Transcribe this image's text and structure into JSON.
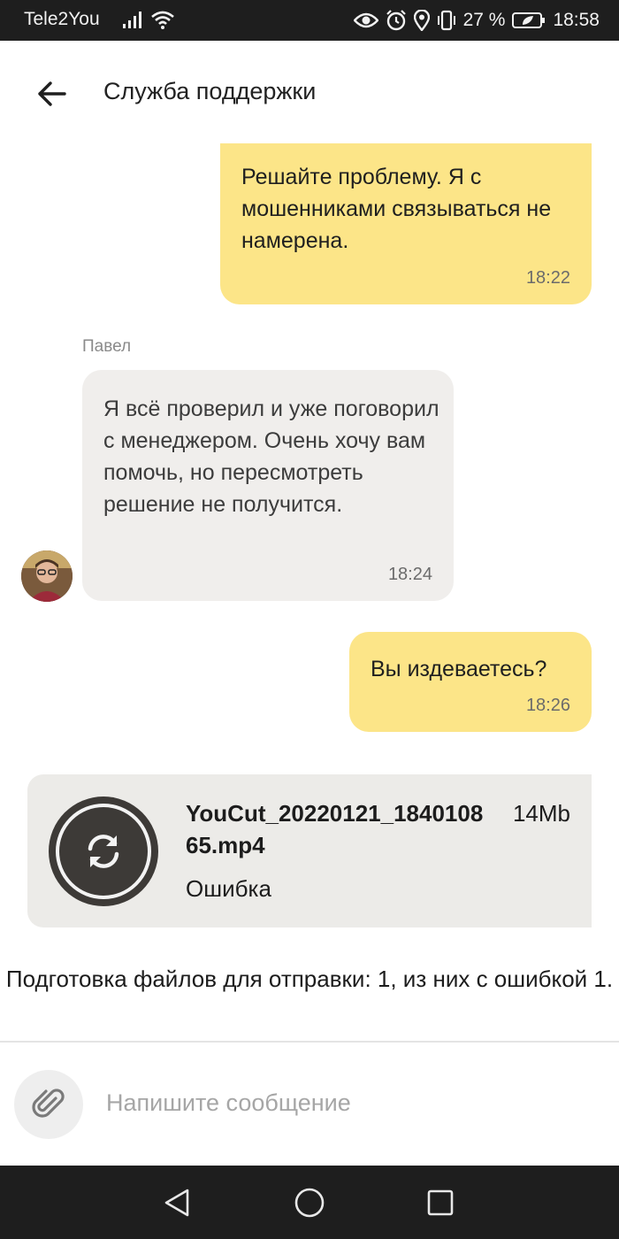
{
  "status_bar": {
    "carrier": "Tele2You",
    "battery": "27 %",
    "time": "18:58"
  },
  "header": {
    "title": "Служба поддержки"
  },
  "messages": [
    {
      "direction": "outgoing",
      "text": "Решайте проблему. Я с мошенниками связываться не намерена.",
      "time": "18:22"
    },
    {
      "direction": "incoming",
      "sender": "Павел",
      "text": "Я всё проверил и уже поговорил с менеджером. Очень хочу вам помочь, но пересмотреть решение не получится.",
      "time": "18:24"
    },
    {
      "direction": "outgoing",
      "text": "Вы издеваетесь?",
      "time": "18:26"
    }
  ],
  "attachment": {
    "filename": "YouCut_20220121_184010865.mp4",
    "size": "14Mb",
    "status": "Ошибка",
    "icon": "retry-icon"
  },
  "upload_status": "Подготовка файлов для отправки: 1, из них с ошибкой 1.",
  "composer": {
    "placeholder": "Напишите сообщение"
  },
  "colors": {
    "outgoing_bubble": "#fce588",
    "incoming_bubble": "#f0eeec",
    "status_bar": "#1e1e1e"
  }
}
